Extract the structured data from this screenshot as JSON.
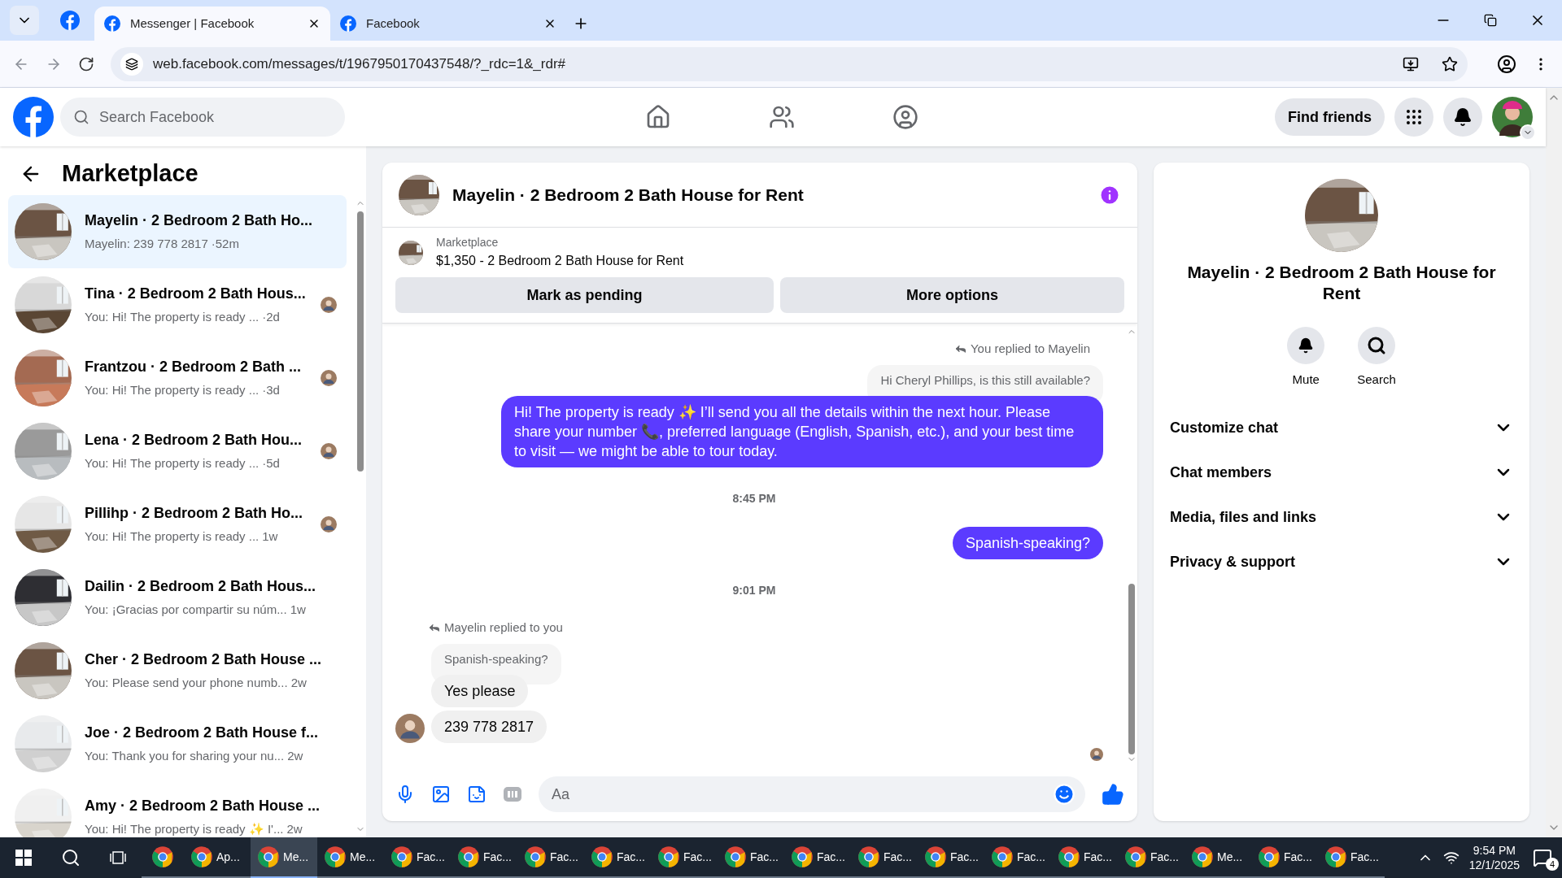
{
  "browser": {
    "tabs": [
      {
        "title": "Messenger | Facebook",
        "selected": true
      },
      {
        "title": "Facebook",
        "selected": false
      }
    ],
    "url": "web.facebook.com/messages/t/1967950170437548/?_rdc=1&_rdr#"
  },
  "header": {
    "search_placeholder": "Search Facebook",
    "find_friends": "Find friends"
  },
  "sidebar": {
    "title": "Marketplace",
    "conversations": [
      {
        "title": "Mayelin · 2 Bedroom 2 Bath Ho...",
        "preview": "Mayelin: 239 778 2817",
        "time": "·52m",
        "selected": true,
        "read_receipt": false
      },
      {
        "title": "Tina · 2 Bedroom 2 Bath Hous...",
        "preview": "You: Hi! The property is ready ...",
        "time": "·2d",
        "selected": false,
        "read_receipt": true
      },
      {
        "title": "Frantzou · 2 Bedroom 2 Bath ...",
        "preview": "You: Hi! The property is ready ...",
        "time": "·3d",
        "selected": false,
        "read_receipt": true
      },
      {
        "title": "Lena · 2 Bedroom 2 Bath Hou...",
        "preview": "You: Hi! The property is ready ...",
        "time": "·5d",
        "selected": false,
        "read_receipt": true
      },
      {
        "title": "Pillihp · 2 Bedroom 2 Bath Ho...",
        "preview": "You: Hi! The property is ready ...",
        "time": "1w",
        "selected": false,
        "read_receipt": true
      },
      {
        "title": "Dailin · 2 Bedroom 2 Bath Hous...",
        "preview": "You: ¡Gracias por compartir su núm...",
        "time": "1w",
        "selected": false,
        "read_receipt": false
      },
      {
        "title": "Cher · 2 Bedroom 2 Bath House ...",
        "preview": "You: Please send your phone numb...",
        "time": "2w",
        "selected": false,
        "read_receipt": false
      },
      {
        "title": "Joe · 2 Bedroom 2 Bath House f...",
        "preview": "You: Thank you for sharing your nu...",
        "time": "2w",
        "selected": false,
        "read_receipt": false
      },
      {
        "title": "Amy · 2 Bedroom 2 Bath House ...",
        "preview": "You: Hi! The property is ready ✨ I'...",
        "time": "2w",
        "selected": false,
        "read_receipt": false
      }
    ]
  },
  "chat": {
    "title": "Mayelin · 2 Bedroom 2 Bath House for Rent",
    "listing_label": "Marketplace",
    "listing_title": "$1,350 - 2 Bedroom 2 Bath House for Rent",
    "buttons": [
      "Mark as pending",
      "More options"
    ],
    "messages": [
      {
        "kind": "reply_note",
        "outgoing": true,
        "text": "You replied to Mayelin"
      },
      {
        "kind": "quote",
        "outgoing": true,
        "text": "Hi Cheryl Phillips, is this still available?"
      },
      {
        "kind": "bubble",
        "outgoing": true,
        "text": "Hi! The property is ready ✨ I’ll send you all the details within the next hour. Please share your number 📞, preferred language (English, Spanish, etc.), and your best time to visit — we might be able to tour today."
      },
      {
        "kind": "time",
        "text": "8:45 PM"
      },
      {
        "kind": "bubble",
        "outgoing": true,
        "text": "Spanish-speaking?"
      },
      {
        "kind": "time",
        "text": "9:01 PM"
      },
      {
        "kind": "reply_note",
        "outgoing": false,
        "text": "Mayelin replied to you"
      },
      {
        "kind": "quote",
        "outgoing": false,
        "text": "Spanish-speaking?"
      },
      {
        "kind": "bubble",
        "outgoing": false,
        "text": "Yes please",
        "avatar": false
      },
      {
        "kind": "bubble",
        "outgoing": false,
        "text": "239 778 2817",
        "avatar": true
      }
    ],
    "composer_placeholder": "Aa"
  },
  "details": {
    "title": "Mayelin · 2 Bedroom 2 Bath House for Rent",
    "actions": [
      {
        "kind": "bell",
        "label": "Mute"
      },
      {
        "kind": "search",
        "label": "Search"
      }
    ],
    "sections": [
      "Customize chat",
      "Chat members",
      "Media, files and links",
      "Privacy & support"
    ]
  },
  "taskbar": {
    "apps": [
      {
        "active": false
      },
      {
        "label": "Ap...",
        "active": false
      },
      {
        "label": "Me...",
        "active": true
      },
      {
        "label": "Me...",
        "active": false
      },
      {
        "label": "Fac...",
        "active": false
      },
      {
        "label": "Fac...",
        "active": false
      },
      {
        "label": "Fac...",
        "active": false
      },
      {
        "label": "Fac...",
        "active": false
      },
      {
        "label": "Fac...",
        "active": false
      },
      {
        "label": "Fac...",
        "active": false
      },
      {
        "label": "Fac...",
        "active": false
      },
      {
        "label": "Fac...",
        "active": false
      },
      {
        "label": "Fac...",
        "active": false
      },
      {
        "label": "Fac...",
        "active": false
      },
      {
        "label": "Fac...",
        "active": false
      },
      {
        "label": "Fac...",
        "active": false
      },
      {
        "label": "Me...",
        "active": false
      },
      {
        "label": "Fac...",
        "active": false
      },
      {
        "label": "Fac...",
        "active": false
      }
    ],
    "time": "9:54 PM",
    "date": "12/1/2025",
    "notifications": "4"
  }
}
